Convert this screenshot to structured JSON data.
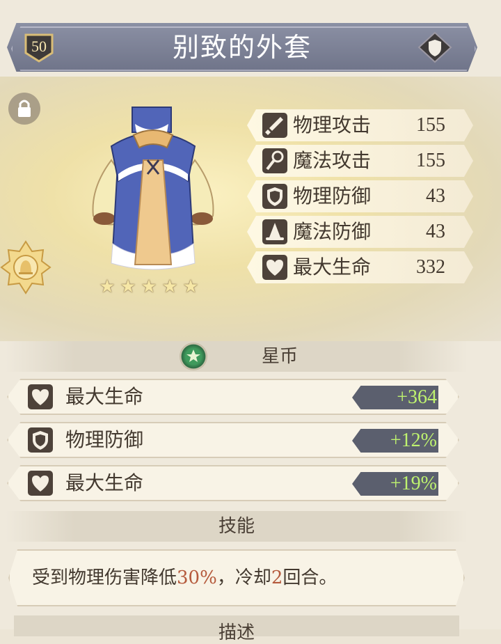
{
  "item": {
    "level": "50",
    "name": "别致的外套",
    "stars": 5
  },
  "stats": [
    {
      "icon": "sword-icon",
      "label": "物理攻击",
      "value": "155"
    },
    {
      "icon": "staff-icon",
      "label": "魔法攻击",
      "value": "155"
    },
    {
      "icon": "shield-icon",
      "label": "物理防御",
      "value": "43"
    },
    {
      "icon": "wizard-hat-icon",
      "label": "魔法防御",
      "value": "43"
    },
    {
      "icon": "heart-icon",
      "label": "最大生命",
      "value": "332"
    }
  ],
  "currency_section": {
    "title": "星币",
    "icon": "star-coin-icon"
  },
  "bonuses": [
    {
      "icon": "heart-icon",
      "label": "最大生命",
      "value": "+364"
    },
    {
      "icon": "shield-icon",
      "label": "物理防御",
      "value": "+12%"
    },
    {
      "icon": "heart-icon",
      "label": "最大生命",
      "value": "+19%"
    }
  ],
  "skill_section": {
    "title": "技能",
    "text_before": "受到物理伤害降低",
    "reduction": "30%",
    "text_middle": "，冷却",
    "cooldown": "2",
    "text_after": "回合。"
  },
  "description_section": {
    "title": "描述"
  },
  "colors": {
    "banner": "#7a7f94",
    "bonus_value": "#bff36f",
    "highlight": "#b55a3c",
    "icon_bg": "#4d423a"
  }
}
